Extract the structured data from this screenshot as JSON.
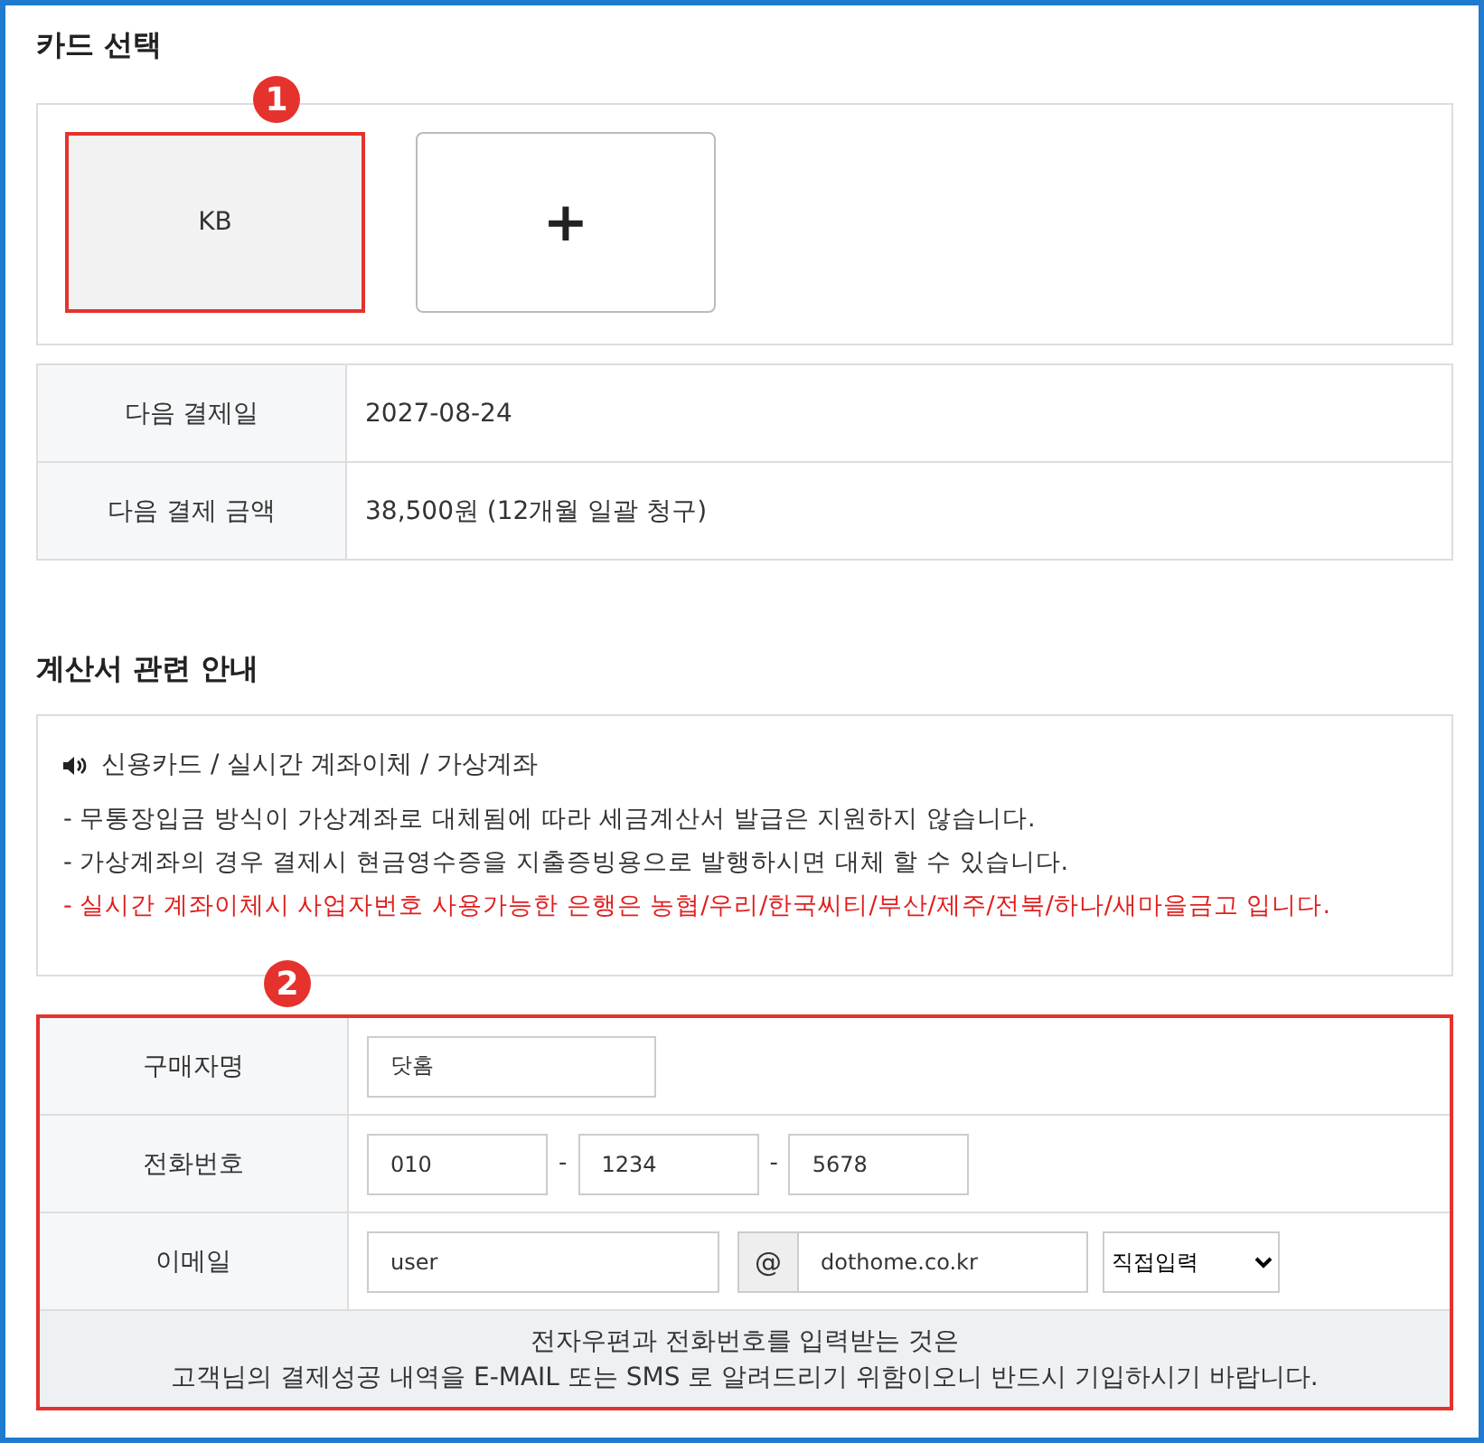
{
  "card_select": {
    "title": "카드 선택",
    "marker": "1",
    "cards": [
      {
        "kind": "card",
        "label": "KB",
        "selected": true
      },
      {
        "kind": "add",
        "label": "+",
        "selected": false
      }
    ]
  },
  "payment": {
    "rows": [
      {
        "label": "다음 결제일",
        "value": "2027-08-24"
      },
      {
        "label": "다음 결제 금액",
        "value": "38,500원 (12개월 일괄 청구)"
      }
    ]
  },
  "invoice": {
    "title": "계산서 관련 안내",
    "heading": "신용카드 / 실시간 계좌이체 / 가상계좌",
    "notes": [
      {
        "text": "- 무통장입금 방식이 가상계좌로 대체됨에 따라 세금계산서 발급은 지원하지 않습니다.",
        "highlight": false
      },
      {
        "text": "- 가상계좌의 경우 결제시 현금영수증을 지출증빙용으로 발행하시면 대체 할 수 있습니다.",
        "highlight": false
      },
      {
        "text": "- 실시간 계좌이체시 사업자번호 사용가능한 은행은 농협/우리/한국씨티/부산/제주/전북/하나/새마을금고 입니다.",
        "highlight": true
      }
    ]
  },
  "buyer_form": {
    "marker": "2",
    "rows": [
      {
        "kind": "text",
        "label": "구매자명",
        "values": [
          "닷홈"
        ]
      },
      {
        "kind": "phone",
        "label": "전화번호",
        "values": [
          "010",
          "1234",
          "5678"
        ],
        "separators": [
          "-",
          "-"
        ]
      },
      {
        "kind": "email",
        "label": "이메일",
        "values": [
          "user",
          "dothome.co.kr"
        ],
        "at": "@",
        "select": "직접입력"
      }
    ],
    "footer": [
      "전자우편과 전화번호를 입력받는 것은",
      "고객님의 결제성공 내역을 E-MAIL 또는 SMS 로 알려드리기 위함이오니 반드시 기입하시기 바랍니다."
    ]
  }
}
